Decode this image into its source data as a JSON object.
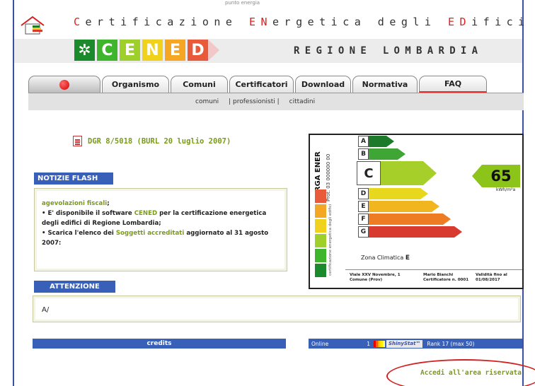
{
  "header": {
    "top_tag": "punto energia",
    "title_parts": [
      {
        "t": "C",
        "red": true
      },
      {
        "t": "ertificazione ",
        "red": false
      },
      {
        "t": "EN",
        "red": true
      },
      {
        "t": "ergetica degli ",
        "red": false
      },
      {
        "t": "ED",
        "red": true
      },
      {
        "t": "ifici",
        "red": false
      }
    ],
    "logo_letters": [
      "",
      "C",
      "E",
      "N",
      "E",
      "D"
    ],
    "logo_colors": [
      "#1b8a2a",
      "#3fb52d",
      "#9fcf2a",
      "#f0d21c",
      "#f5a623",
      "#e85a3a"
    ],
    "region": "REGIONE LOMBARDIA"
  },
  "nav": {
    "tabs": [
      {
        "label": "",
        "w": 0
      },
      {
        "label": "Organismo"
      },
      {
        "label": "Comuni"
      },
      {
        "label": "Certificatori"
      },
      {
        "label": "Download"
      },
      {
        "label": "Normativa"
      },
      {
        "label": "FAQ"
      }
    ],
    "subnav": [
      "comuni",
      "| professionisti |",
      "cittadini"
    ]
  },
  "content": {
    "dgr_link": "DGR 8/5018 (BURL 20 luglio 2007)",
    "notizie_title": "NOTIZIE FLASH",
    "notizie_lines": [
      {
        "text": "agevolazioni fiscali",
        "green": true,
        "suffix": ";"
      },
      {
        "prefix": "• E' disponibile il software ",
        "text": "CENED",
        "green": true,
        "suffix": " per la certificazione energetica degli edifici di Regione Lombardia;"
      },
      {
        "prefix": "• Scarica l'elenco dei ",
        "text": "Soggetti accreditati",
        "green": true,
        "suffix": " aggiornato al 31 agosto 2007:"
      }
    ],
    "attenzione_title": "ATTENZIONE",
    "attenzione_text": "A/",
    "credits": "credits"
  },
  "energy_label": {
    "side_title": "TARGA ENER",
    "side_protocol": "Prot. 03 000000 00",
    "side_small": "certificazione energetica degli edifici",
    "classes": [
      {
        "letter": "A",
        "color": "#1c7a2a"
      },
      {
        "letter": "B",
        "color": "#3fa535"
      },
      {
        "letter": "C",
        "color": "#a6cf2a",
        "big": true
      },
      {
        "letter": "D",
        "color": "#e7d81e"
      },
      {
        "letter": "E",
        "color": "#f1b51f"
      },
      {
        "letter": "F",
        "color": "#ed7c22"
      },
      {
        "letter": "G",
        "color": "#d93a2f"
      }
    ],
    "value": "65",
    "unit": "kWh/m²a",
    "zona_label": "Zona Climatica",
    "zona_value": "E",
    "address": "Viale XXV Novembre, 1\nComune (Prov)",
    "certifier": "Mario Bianchi\nCertificatore n. 0001",
    "validity": "Validità fino al\n01/08/2017"
  },
  "status": {
    "online_label": "Online",
    "online_count": "1",
    "shinystat": "ShinyStat™",
    "rank": "Rank   17 (max 50)"
  },
  "access_link": "Accedi all'area riservata"
}
